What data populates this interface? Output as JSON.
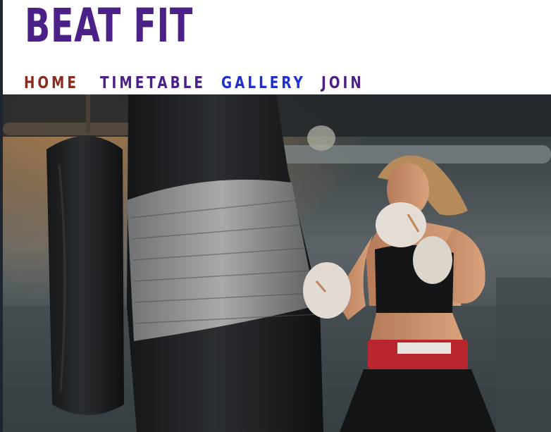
{
  "brand": {
    "name": "BEAT FIT",
    "color": "#4b2187"
  },
  "nav": {
    "items": [
      {
        "label": "HOME",
        "color": "#8b2a1f"
      },
      {
        "label": "TIMETABLE",
        "color": "#4b2187"
      },
      {
        "label": "GALLERY",
        "color": "#1f2fd0"
      },
      {
        "label": "JOIN",
        "color": "#4b2187"
      }
    ]
  },
  "hero": {
    "icon": "boxer-punching-bag-photo"
  }
}
